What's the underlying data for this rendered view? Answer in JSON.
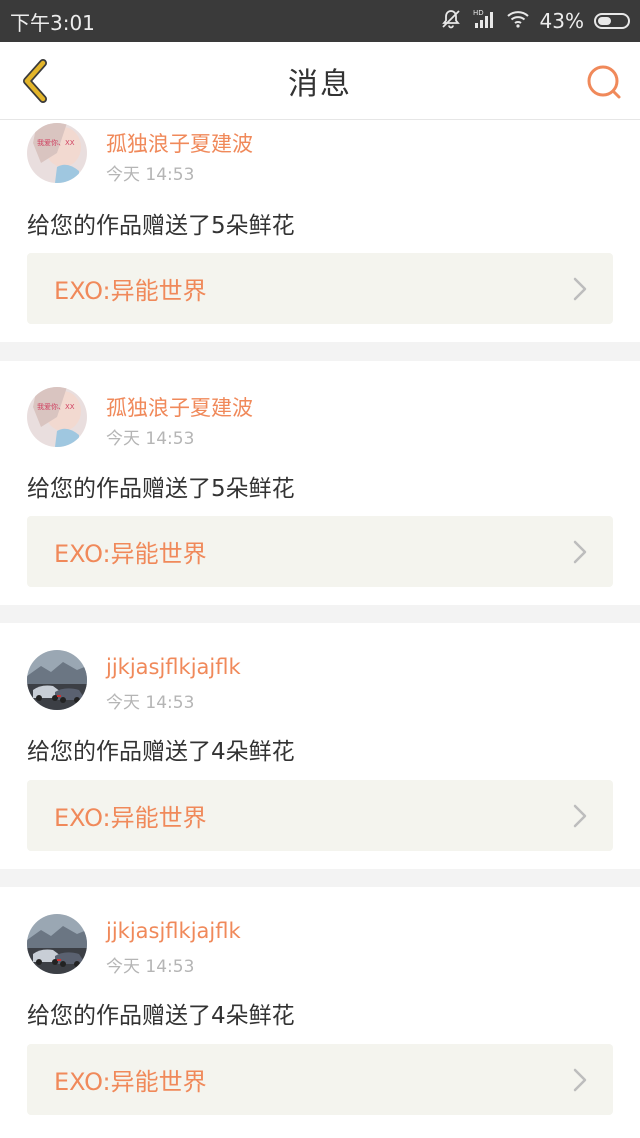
{
  "status_bar": {
    "time": "下午3:01",
    "battery": "43%",
    "icons": [
      "mute-icon",
      "signal-icon",
      "wifi-icon",
      "battery-icon"
    ]
  },
  "header": {
    "title": "消息"
  },
  "colors": {
    "accent": "#f0895a",
    "link_bg": "#f4f4ee",
    "back_arrow": "#e3b52a"
  },
  "messages": [
    {
      "username": "孤独浪子夏建波",
      "time": "今天 14:53",
      "text": "给您的作品赠送了5朵鲜花",
      "work": "EXO:异能世界",
      "avatar": "girl"
    },
    {
      "username": "孤独浪子夏建波",
      "time": "今天 14:53",
      "text": "给您的作品赠送了5朵鲜花",
      "work": "EXO:异能世界",
      "avatar": "girl"
    },
    {
      "username": "jjkjasjflkjajflk",
      "time": "今天 14:53",
      "text": "给您的作品赠送了4朵鲜花",
      "work": "EXO:异能世界",
      "avatar": "car"
    },
    {
      "username": "jjkjasjflkjajflk",
      "time": "今天 14:53",
      "text": "给您的作品赠送了4朵鲜花",
      "work": "EXO:异能世界",
      "avatar": "car"
    }
  ]
}
